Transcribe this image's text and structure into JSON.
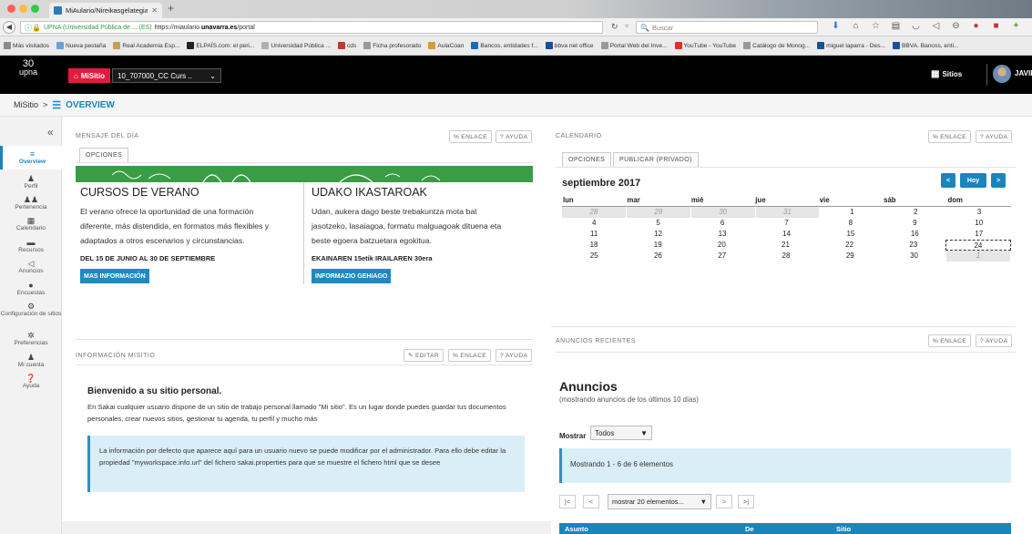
{
  "browser": {
    "tab_title": "MiAulario/Nireikasgelategia | M",
    "new_tab": "+",
    "url_site": "UPNA (Universidad Pública de ... (ES)",
    "url_prefix": "https://miaulario.",
    "url_domain": "unavarra.es",
    "url_suffix": "/portal",
    "search_placeholder": "Buscar",
    "bookmarks": [
      {
        "label": "Más visitados",
        "color": "#8a8a8a"
      },
      {
        "label": "Nueva pestaña",
        "color": "#6aa0d8"
      },
      {
        "label": "Real Academia Esp...",
        "color": "#c7a14a"
      },
      {
        "label": "ELPAÍS.com: el peri...",
        "color": "#222222"
      },
      {
        "label": "Universidad Pública ...",
        "color": "#b0b0b0"
      },
      {
        "label": "cds",
        "color": "#c0392b"
      },
      {
        "label": "Ficha profesorado",
        "color": "#999999"
      },
      {
        "label": "AulaCoan",
        "color": "#d0a030"
      },
      {
        "label": "Bancos, entidades f...",
        "color": "#1a6bbf"
      },
      {
        "label": "bbva net office",
        "color": "#1a4f9c"
      },
      {
        "label": "Portal Web del Inve...",
        "color": "#999999"
      },
      {
        "label": "YouTube - YouTube",
        "color": "#e52d27"
      },
      {
        "label": "Catálogo de Monog...",
        "color": "#999999"
      },
      {
        "label": "miguel laparra - Des...",
        "color": "#1a4f9c"
      },
      {
        "label": "BBVA. Bancos, enti...",
        "color": "#1a4f9c"
      }
    ]
  },
  "header": {
    "logo_top": "30",
    "logo_bottom": "upna",
    "misitio": "MiSitio",
    "site_select": "10_707000_CC Curs ..",
    "sitios": "Sitios",
    "user": "JAVIER"
  },
  "breadcrumb": {
    "site": "MiSitio",
    "sep": ">",
    "current": "OVERVIEW"
  },
  "leftnav": {
    "collapse": "«",
    "items": [
      {
        "label": "Overview",
        "icon": "≡"
      },
      {
        "label": "Perfil",
        "icon": "♟"
      },
      {
        "label": "Pertenencia",
        "icon": "♟♟"
      },
      {
        "label": "Calendario",
        "icon": "▦"
      },
      {
        "label": "Recursos",
        "icon": "▬"
      },
      {
        "label": "Anuncios",
        "icon": "◁"
      },
      {
        "label": "Encuestas",
        "icon": "●"
      },
      {
        "label": "Configuración de sitios",
        "icon": "⚙"
      },
      {
        "label": "Preferencias",
        "icon": "✲"
      },
      {
        "label": "Mi cuenta",
        "icon": "♟"
      },
      {
        "label": "Ayuda",
        "icon": "❓"
      }
    ]
  },
  "buttons": {
    "enlace": "ENLACE",
    "ayuda": "AYUDA",
    "editar": "EDITAR",
    "opciones": "OPCIONES",
    "publicar": "PUBLICAR (PRIVADO)"
  },
  "motd": {
    "title": "MENSAJE DEL DÍA",
    "left": {
      "heading": "CURSOS DE VERANO",
      "line1": "El verano ofrece la oportunidad de una formación",
      "line2": "diferente, más distendida, en formatos más flexibles y",
      "line3": "adaptados a otros escenarios y circunstancias.",
      "date": "DEL 15 DE JUNIO AL 30 DE SEPTIEMBRE",
      "button": "MAS INFORMACIÓN"
    },
    "right": {
      "heading": "UDAKO IKASTAROAK",
      "line1": "Udan, aukera dago beste trebakuntza mota bat",
      "line2": "jasotzeko, lasaiagoa, formatu malguagoak dituena eta",
      "line3": "beste egoera batzuetara egokitua.",
      "date": "EKAINAREN 15etik IRAILAREN 30era",
      "button": "INFORMAZIO GEHIAGO"
    }
  },
  "info": {
    "title": "INFORMACIÓN MISITIO",
    "heading": "Bienvenido a su sitio personal.",
    "paragraph": "En Sakai cualquier usuario dispone de un sitio de trabajo personal llamado \"Mi sitio\". Es un lugar donde puedes guardar tus documentos personales, crear nuevos sitios, gestionar tu agenda, tu perfil y mucho más",
    "note": "La información por defecto que aparece aquí para un usuario nuevo se puede modificar por el administrador. Para ello debe editar la propiedad \"myworkspace.info.url\" del fichero sakai.properties para que se muestre el fichero html que se desee"
  },
  "calendar": {
    "title": "CALENDARIO",
    "month": "septiembre 2017",
    "prev": "<",
    "today": "Hoy",
    "next": ">",
    "days": [
      "lun",
      "mar",
      "mié",
      "jue",
      "vie",
      "sáb",
      "dom"
    ],
    "weeks": [
      [
        "28",
        "29",
        "30",
        "31",
        "1",
        "2",
        "3"
      ],
      [
        "4",
        "5",
        "6",
        "7",
        "8",
        "9",
        "10"
      ],
      [
        "11",
        "12",
        "13",
        "14",
        "15",
        "16",
        "17"
      ],
      [
        "18",
        "19",
        "20",
        "21",
        "22",
        "23",
        "24"
      ],
      [
        "25",
        "26",
        "27",
        "28",
        "29",
        "30",
        "1"
      ]
    ]
  },
  "announcements": {
    "title": "ANUNCIOS RECIENTES",
    "heading": "Anuncios",
    "subtitle": "(mostrando anuncios de los últimos 10 días)",
    "mostrar_label": "Mostrar",
    "mostrar_value": "Todos",
    "info": "Mostrando 1 - 6 de 6 elementos",
    "first": "|<",
    "prev": "<",
    "page_size": "mostrar 20 elementos...",
    "next": ">",
    "last": ">|",
    "columns": [
      "Asunto",
      "De",
      "Sitio"
    ]
  }
}
